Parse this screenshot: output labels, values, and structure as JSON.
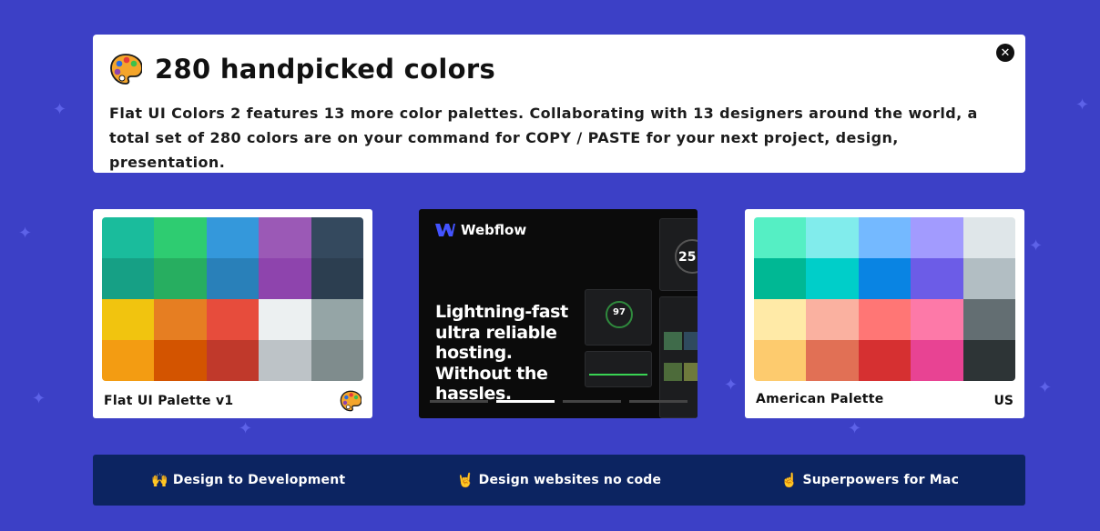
{
  "banner": {
    "title": "280 handpicked colors",
    "description": "Flat UI Colors 2 features 13 more color palettes. Collaborating with 13 designers around the world, a total set of 280 colors are on your command for COPY / PASTE for your next project, design, presentation.",
    "close_icon": "close-icon",
    "title_icon": "palette-icon"
  },
  "palettes": [
    {
      "name": "Flat UI Palette v1",
      "badge_icon": "palette-icon",
      "colors": [
        "#1abc9c",
        "#2ecc71",
        "#3498db",
        "#9b59b6",
        "#34495e",
        "#16a085",
        "#27ae60",
        "#2980b9",
        "#8e44ad",
        "#2c3e50",
        "#f1c40f",
        "#e67e22",
        "#e74c3c",
        "#ecf0f1",
        "#95a5a6",
        "#f39c12",
        "#d35400",
        "#c0392b",
        "#bdc3c7",
        "#7f8c8d"
      ]
    },
    {
      "name": "American Palette",
      "badge": "US",
      "colors": [
        "#55efc4",
        "#81ecec",
        "#74b9ff",
        "#a29bfe",
        "#dfe6e9",
        "#00b894",
        "#00cec9",
        "#0984e3",
        "#6c5ce7",
        "#b2bec3",
        "#ffeaa7",
        "#fab1a0",
        "#ff7675",
        "#fd79a8",
        "#636e72",
        "#fdcb6e",
        "#e17055",
        "#d63031",
        "#e84393",
        "#2d3436"
      ]
    }
  ],
  "ad": {
    "brand": "Webflow",
    "headline": [
      "Lightning-fast",
      "ultra reliable",
      "hosting.",
      "Without the",
      "hassles."
    ],
    "gauge_value": "97",
    "side_value": "25"
  },
  "promo": [
    {
      "icon": "🙌",
      "label": "Design to Development"
    },
    {
      "icon": "🤘",
      "label": "Design websites no code"
    },
    {
      "icon": "☝️",
      "label": "Superpowers for Mac"
    }
  ],
  "colors": {
    "background": "#3c40c6",
    "promo_bar": "#0c2461",
    "sparkle": "#5d62e8"
  }
}
